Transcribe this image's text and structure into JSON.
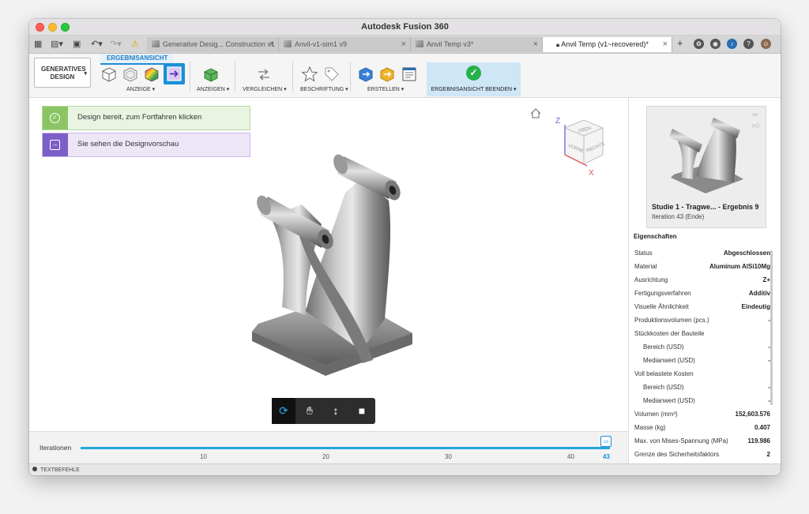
{
  "window": {
    "title": "Autodesk Fusion 360"
  },
  "tabs": [
    {
      "label": "Generative Desig... Construction v1",
      "active": false
    },
    {
      "label": "Anvil-v1-sim1 v9",
      "active": false
    },
    {
      "label": "Anvil Temp v3*",
      "active": false
    },
    {
      "label": "Anvil Temp (v1~recovered)*",
      "active": true
    }
  ],
  "toolbar": {
    "workspace": "GENERATIVES DESIGN",
    "active_tab": "ERGEBNISANSICHT",
    "groups": [
      "ANZEIGE",
      "ANZEIGEN",
      "VERGLEICHEN",
      "BESCHRIFTUNG",
      "ERSTELLEN"
    ],
    "finish_label": "ERGEBNISANSICHT BEENDEN"
  },
  "notices": [
    {
      "text": "Design bereit, zum Fortfahren klicken",
      "color": "#8bc563"
    },
    {
      "text": "Sie sehen die Designvorschau",
      "color": "#7b5fc6"
    }
  ],
  "viewcube": {
    "axis_z": "Z",
    "axis_x": "X",
    "faces": [
      "OBEN",
      "VORNE",
      "RECHTS"
    ]
  },
  "timeline": {
    "label": "Iterationen",
    "ticks": [
      "10",
      "20",
      "30",
      "40"
    ],
    "current": "43"
  },
  "statusbar": {
    "label": "TEXTBEFEHLE"
  },
  "result": {
    "title": "Studie 1 - Tragwe... - Ergebnis 9",
    "iteration": "Iteration 43 (Ende)"
  },
  "properties": {
    "title": "Eigenschaften",
    "rows": [
      {
        "k": "Status",
        "v": "Abgeschlossen"
      },
      {
        "k": "Material",
        "v": "Aluminum AlSi10Mg"
      },
      {
        "k": "Ausrichtung",
        "v": "Z+"
      },
      {
        "k": "Fertigungsverfahren",
        "v": "Additiv"
      },
      {
        "k": "Visuelle Ähnlichkeit",
        "v": "Eindeutig"
      },
      {
        "k": "Produktionsvolumen (pcs.)",
        "v": "-"
      },
      {
        "k": "Stückkosten der Bauteile",
        "v": ""
      },
      {
        "k": "Bereich (USD)",
        "v": "-",
        "indent": true
      },
      {
        "k": "Medianwert (USD)",
        "v": "-",
        "indent": true
      },
      {
        "k": "Voll belastete Kosten",
        "v": ""
      },
      {
        "k": "Bereich (USD)",
        "v": "-",
        "indent": true
      },
      {
        "k": "Medianwert (USD)",
        "v": "-",
        "indent": true
      },
      {
        "k": "Volumen (mm³)",
        "v": "152,603.576"
      },
      {
        "k": "Masse (kg)",
        "v": "0.407"
      },
      {
        "k": "Max. von Mises-Spannung (MPa)",
        "v": "119.986"
      },
      {
        "k": "Grenze des Sicherheitsfaktors",
        "v": "2"
      }
    ]
  }
}
